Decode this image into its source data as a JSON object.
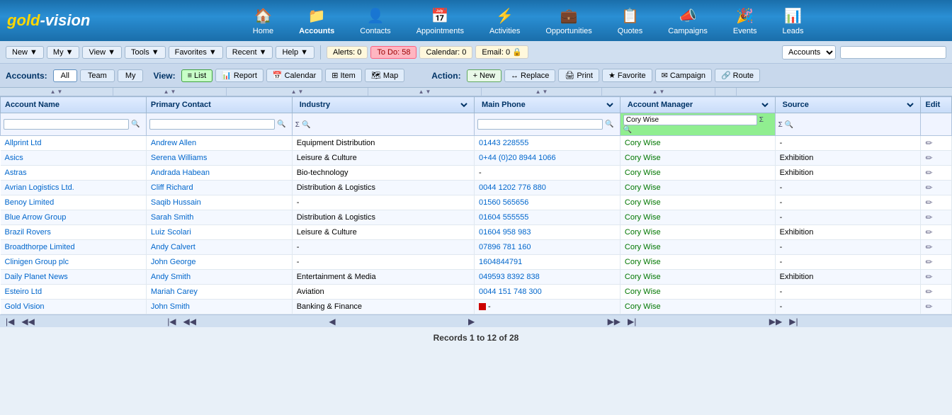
{
  "header": {
    "logo": "gold-vision",
    "nav": [
      {
        "id": "home",
        "label": "Home",
        "icon": "🏠"
      },
      {
        "id": "accounts",
        "label": "Accounts",
        "icon": "📁",
        "active": true
      },
      {
        "id": "contacts",
        "label": "Contacts",
        "icon": "👤"
      },
      {
        "id": "appointments",
        "label": "Appointments",
        "icon": "📅"
      },
      {
        "id": "activities",
        "label": "Activities",
        "icon": "⚡"
      },
      {
        "id": "opportunities",
        "label": "Opportunities",
        "icon": "💼"
      },
      {
        "id": "quotes",
        "label": "Quotes",
        "icon": "📋"
      },
      {
        "id": "campaigns",
        "label": "Campaigns",
        "icon": "📣"
      },
      {
        "id": "events",
        "label": "Events",
        "icon": "🎉"
      },
      {
        "id": "leads",
        "label": "Leads",
        "icon": "📊"
      }
    ]
  },
  "toolbar": {
    "new_label": "New",
    "my_label": "My",
    "view_label": "View",
    "tools_label": "Tools",
    "favorites_label": "Favorites",
    "recent_label": "Recent",
    "help_label": "Help",
    "alerts_label": "Alerts:",
    "alerts_count": "0",
    "todo_label": "To Do:",
    "todo_count": "58",
    "calendar_label": "Calendar:",
    "calendar_count": "0",
    "email_label": "Email:",
    "email_count": "0",
    "search_select_value": "Accounts",
    "search_placeholder": ""
  },
  "viewbar": {
    "accounts_label": "Accounts:",
    "all_label": "All",
    "team_label": "Team",
    "my_label": "My",
    "view_label": "View:",
    "list_label": "List",
    "report_label": "Report",
    "calendar_label": "Calendar",
    "item_label": "Item",
    "map_label": "Map",
    "action_label": "Action:",
    "new_label": "New",
    "replace_label": "Replace",
    "print_label": "Print",
    "favorite_label": "Favorite",
    "campaign_label": "Campaign",
    "route_label": "Route"
  },
  "columns": {
    "account_name": "Account Name",
    "primary_contact": "Primary Contact",
    "industry": "Industry",
    "main_phone": "Main Phone",
    "account_manager": "Account Manager",
    "source": "Source",
    "edit": "Edit"
  },
  "filter": {
    "account_manager_value": "Cory Wise"
  },
  "rows": [
    {
      "account": "Allprint Ltd",
      "contact": "Andrew Allen",
      "industry": "Equipment Distribution",
      "phone": "01443 228555",
      "manager": "Cory Wise",
      "source": "-",
      "has_flag": false
    },
    {
      "account": "Asics",
      "contact": "Serena Williams",
      "industry": "Leisure & Culture",
      "phone": "0+44 (0)20 8944 1066",
      "manager": "Cory Wise",
      "source": "Exhibition",
      "has_flag": false
    },
    {
      "account": "Astras",
      "contact": "Andrada Habean",
      "industry": "Bio-technology",
      "phone": "",
      "manager": "Cory Wise",
      "source": "Exhibition",
      "has_flag": false
    },
    {
      "account": "Avrian Logistics Ltd.",
      "contact": "Cliff Richard",
      "industry": "Distribution & Logistics",
      "phone": "0044 1202 776 880",
      "manager": "Cory Wise",
      "source": "-",
      "has_flag": false
    },
    {
      "account": "Benoy Limited",
      "contact": "Saqib Hussain",
      "industry": "-",
      "phone": "01560 565656",
      "manager": "Cory Wise",
      "source": "-",
      "has_flag": false
    },
    {
      "account": "Blue Arrow Group",
      "contact": "Sarah Smith",
      "industry": "Distribution & Logistics",
      "phone": "01604 555555",
      "manager": "Cory Wise",
      "source": "-",
      "has_flag": false
    },
    {
      "account": "Brazil Rovers",
      "contact": "Luiz Scolari",
      "industry": "Leisure & Culture",
      "phone": "01604 958 983",
      "manager": "Cory Wise",
      "source": "Exhibition",
      "has_flag": false
    },
    {
      "account": "Broadthorpe Limited",
      "contact": "Andy Calvert",
      "industry": "-",
      "phone": "07896 781 160",
      "manager": "Cory Wise",
      "source": "-",
      "has_flag": false
    },
    {
      "account": "Clinigen Group plc",
      "contact": "John George",
      "industry": "-",
      "phone": "1604844791",
      "manager": "Cory Wise",
      "source": "-",
      "has_flag": false
    },
    {
      "account": "Daily Planet News",
      "contact": "Andy Smith",
      "industry": "Entertainment & Media",
      "phone": "049593 8392 838",
      "manager": "Cory Wise",
      "source": "Exhibition",
      "has_flag": false
    },
    {
      "account": "Esteiro Ltd",
      "contact": "Mariah Carey",
      "industry": "Aviation",
      "phone": "0044 151 748 300",
      "manager": "Cory Wise",
      "source": "-",
      "has_flag": false
    },
    {
      "account": "Gold Vision",
      "contact": "John Smith",
      "industry": "Banking & Finance",
      "phone": "-",
      "manager": "Cory Wise",
      "source": "-",
      "has_flag": true
    }
  ],
  "pagination": {
    "records_text": "Records 1 to 12 of 28"
  }
}
